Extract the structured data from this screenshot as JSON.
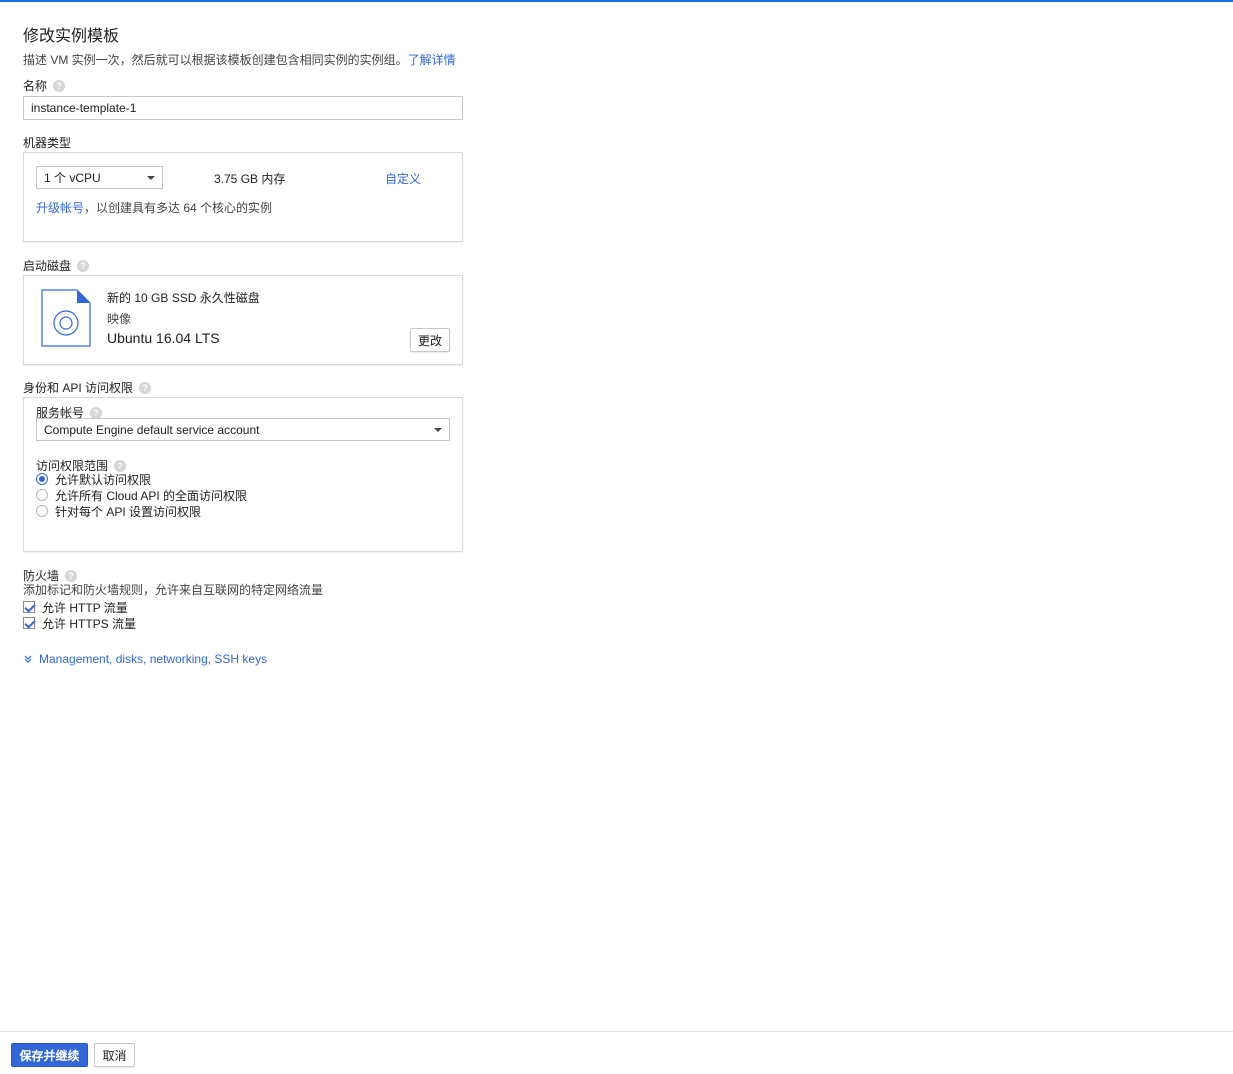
{
  "page": {
    "title": "修改实例模板",
    "description": "描述 VM 实例一次，然后就可以根据该模板创建包含相同实例的实例组。",
    "learn_more": "了解详情"
  },
  "name_field": {
    "label": "名称",
    "value": "instance-template-1"
  },
  "machine_type": {
    "label": "机器类型",
    "cpu_select": "1 个 vCPU",
    "memory": "3.75 GB 内存",
    "customize": "自定义",
    "upgrade_link": "升级帐号",
    "upgrade_text": "，以创建具有多达 64 个核心的实例"
  },
  "boot_disk": {
    "label": "启动磁盘",
    "disk_desc": "新的 10 GB SSD 永久性磁盘",
    "image_label": "映像",
    "image_name": "Ubuntu 16.04 LTS",
    "change_button": "更改"
  },
  "identity": {
    "label": "身份和 API 访问权限",
    "service_account_label": "服务帐号",
    "service_account_value": "Compute Engine default service account",
    "scope_label": "访问权限范围",
    "scopes": [
      {
        "label": "允许默认访问权限",
        "selected": true
      },
      {
        "label": "允许所有 Cloud API 的全面访问权限",
        "selected": false
      },
      {
        "label": "针对每个 API 设置访问权限",
        "selected": false
      }
    ]
  },
  "firewall": {
    "label": "防火墙",
    "description": "添加标记和防火墙规则，允许来自互联网的特定网络流量",
    "http": "允许 HTTP 流量",
    "https": "允许 HTTPS 流量"
  },
  "advanced": {
    "label": "Management, disks, networking, SSH keys"
  },
  "footer": {
    "save": "保存并继续",
    "cancel": "取消"
  },
  "colors": {
    "accent": "#3367d6",
    "top_bar": "#1a73e8"
  }
}
